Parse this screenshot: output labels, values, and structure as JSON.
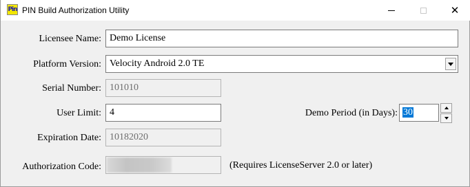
{
  "window": {
    "title": "PIN Build Authorization Utility",
    "icon_text": "Pin",
    "minimize_icon": "minimize-icon",
    "maximize_icon": "maximize-icon",
    "close_icon": "close-icon",
    "close_glyph": "✕"
  },
  "form": {
    "licensee_name": {
      "label": "Licensee Name:",
      "value": "Demo License"
    },
    "platform_version": {
      "label": "Platform Version:",
      "value": "Velocity Android 2.0 TE"
    },
    "serial_number": {
      "label": "Serial Number:",
      "value": "101010"
    },
    "user_limit": {
      "label": "User Limit:",
      "value": "4"
    },
    "demo_period": {
      "label": "Demo Period (in Days):",
      "value": "30"
    },
    "expiration_date": {
      "label": "Expiration Date:",
      "value": "10182020"
    },
    "authorization_code": {
      "label": "Authorization Code:",
      "value": "",
      "note": "(Requires LicenseServer 2.0 or later)"
    }
  },
  "colors": {
    "selection": "#0078d7",
    "title_bar": "#ffffff",
    "window_bg": "#f0f0f0"
  }
}
